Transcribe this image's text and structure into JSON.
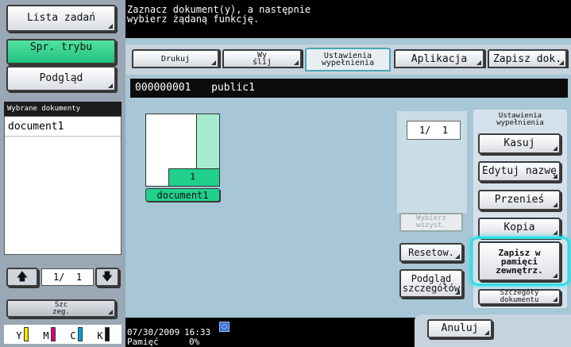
{
  "left": {
    "job_list_label": "Lista zadań",
    "mode_check_label": "Spr. trybu",
    "preview_label": "Podgląd",
    "selected_docs_header": "Wybrane dokumenty",
    "selected_docs": [
      "document1"
    ],
    "page_indicator": "1/  1",
    "detail_label": "Szc\nzeg.",
    "toner": [
      "Y",
      "M",
      "C",
      "K"
    ]
  },
  "header": {
    "message": "Zaznacz dokument(y), a następnie\nwybierz żądaną funkcję."
  },
  "tabs": [
    {
      "label": "Drukuj"
    },
    {
      "label": "Wy\nślij"
    },
    {
      "label": "Ustawienia\nwypełnienia"
    },
    {
      "label": "Aplikacja"
    },
    {
      "label": "Zapisz dok."
    }
  ],
  "box": {
    "number": "000000001",
    "name": "public1"
  },
  "document": {
    "name": "document1",
    "count": "1"
  },
  "page_counter": "1/  1",
  "buttons": {
    "select_all": "Wybierz\nwszyst.",
    "reset": "Resetow.",
    "detail_preview": "Podgląd\nszczegółów",
    "panel_title": "Ustawienia\nwypełnienia",
    "delete": "Kasuj",
    "edit_name": "Edytuj nazwę",
    "move": "Przenieś",
    "copy": "Kopia",
    "save_external": "Zapisz w\npamięci\nzewnętrz.",
    "doc_details": "Szczegóły\ndokumentu",
    "cancel": "Anuluj"
  },
  "status": {
    "date": "07/30/2009",
    "time": "16:33",
    "memory_label": "Pamięć",
    "memory_value": "0%"
  }
}
